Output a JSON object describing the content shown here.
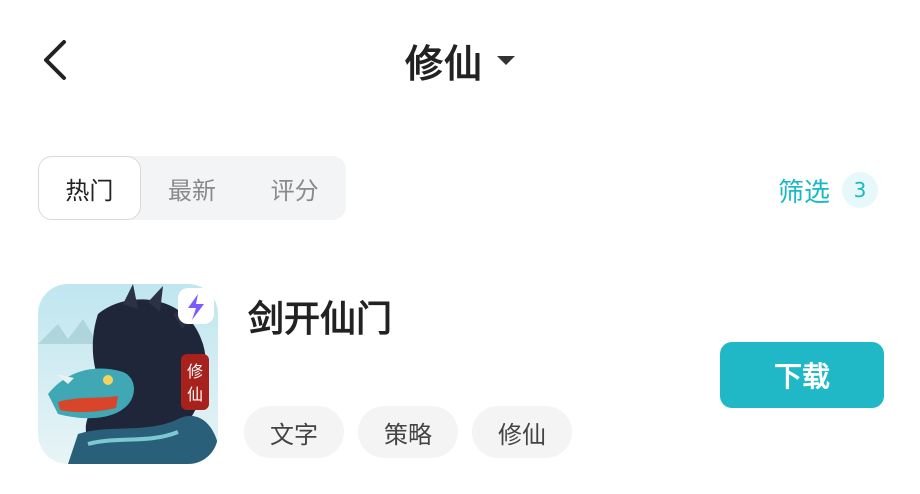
{
  "header": {
    "title": "修仙",
    "back_icon": "chevron-left-icon",
    "dropdown_icon": "caret-down-icon"
  },
  "sort_tabs": [
    {
      "label": "热门",
      "active": true
    },
    {
      "label": "最新",
      "active": false
    },
    {
      "label": "评分",
      "active": false
    }
  ],
  "filter": {
    "label": "筛选",
    "count": "3",
    "color": "#19b9c4"
  },
  "apps": [
    {
      "name": "剑开仙门",
      "icon": "dragon-game-icon",
      "icon_badge_text": "修仙",
      "tags": [
        "文字",
        "策略",
        "修仙"
      ],
      "action_label": "下载",
      "action_color": "#20b8c6"
    }
  ]
}
